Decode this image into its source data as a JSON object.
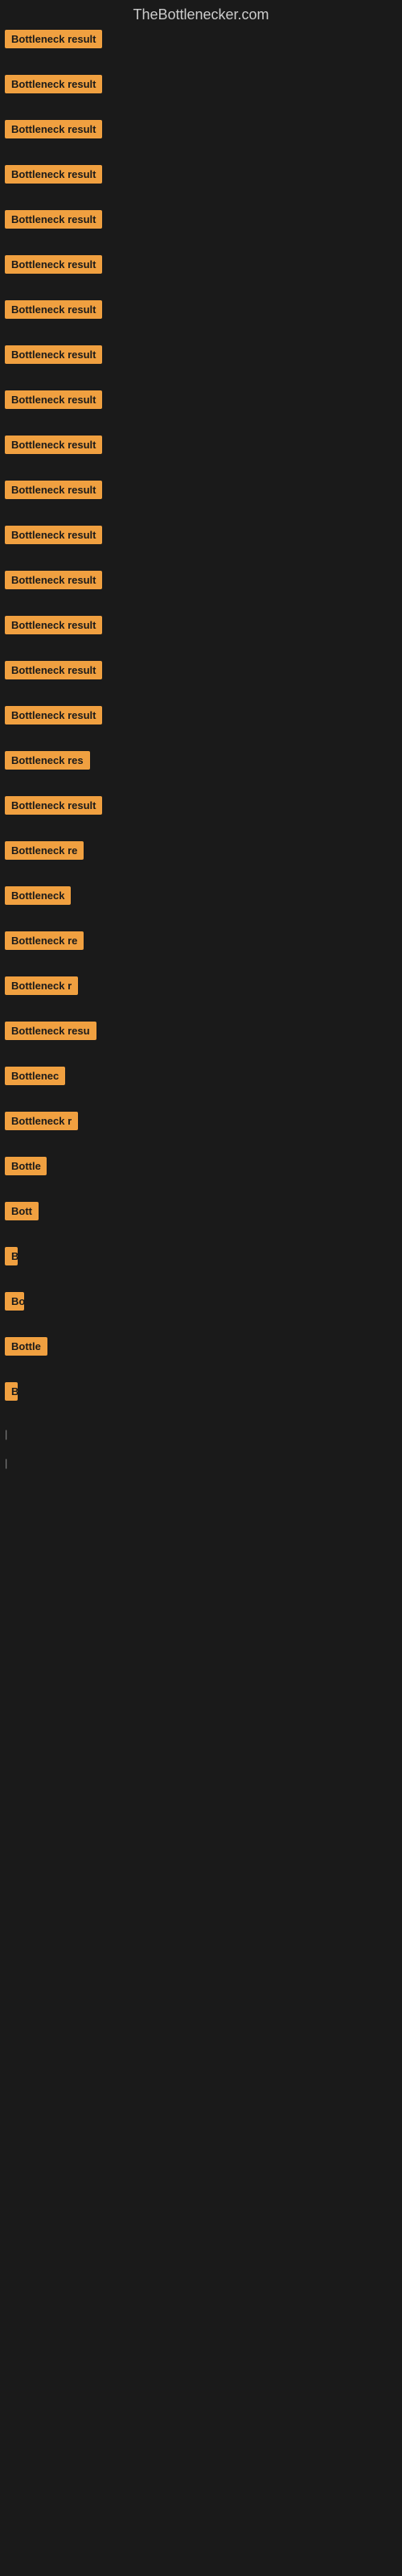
{
  "site": {
    "title": "TheBottlenecker.com"
  },
  "items": [
    {
      "label": "Bottleneck result",
      "width": 155
    },
    {
      "label": "Bottleneck result",
      "width": 155
    },
    {
      "label": "Bottleneck result",
      "width": 155
    },
    {
      "label": "Bottleneck result",
      "width": 155
    },
    {
      "label": "Bottleneck result",
      "width": 155
    },
    {
      "label": "Bottleneck result",
      "width": 155
    },
    {
      "label": "Bottleneck result",
      "width": 155
    },
    {
      "label": "Bottleneck result",
      "width": 155
    },
    {
      "label": "Bottleneck result",
      "width": 155
    },
    {
      "label": "Bottleneck result",
      "width": 155
    },
    {
      "label": "Bottleneck result",
      "width": 155
    },
    {
      "label": "Bottleneck result",
      "width": 155
    },
    {
      "label": "Bottleneck result",
      "width": 155
    },
    {
      "label": "Bottleneck result",
      "width": 155
    },
    {
      "label": "Bottleneck result",
      "width": 155
    },
    {
      "label": "Bottleneck result",
      "width": 155
    },
    {
      "label": "Bottleneck res",
      "width": 128
    },
    {
      "label": "Bottleneck result",
      "width": 155
    },
    {
      "label": "Bottleneck re",
      "width": 118
    },
    {
      "label": "Bottleneck",
      "width": 90
    },
    {
      "label": "Bottleneck re",
      "width": 118
    },
    {
      "label": "Bottleneck r",
      "width": 105
    },
    {
      "label": "Bottleneck resu",
      "width": 132
    },
    {
      "label": "Bottlenec",
      "width": 82
    },
    {
      "label": "Bottleneck r",
      "width": 108
    },
    {
      "label": "Bottle",
      "width": 52
    },
    {
      "label": "Bott",
      "width": 42
    },
    {
      "label": "B",
      "width": 16
    },
    {
      "label": "Bo",
      "width": 24
    },
    {
      "label": "Bottle",
      "width": 54
    },
    {
      "label": "B",
      "width": 14
    },
    {
      "label": "",
      "width": 0
    },
    {
      "label": "",
      "width": 0
    },
    {
      "label": "|",
      "width": 10
    },
    {
      "label": "",
      "width": 0
    },
    {
      "label": "",
      "width": 0
    },
    {
      "label": "",
      "width": 0
    },
    {
      "label": "",
      "width": 0
    },
    {
      "label": "|",
      "width": 10
    }
  ]
}
